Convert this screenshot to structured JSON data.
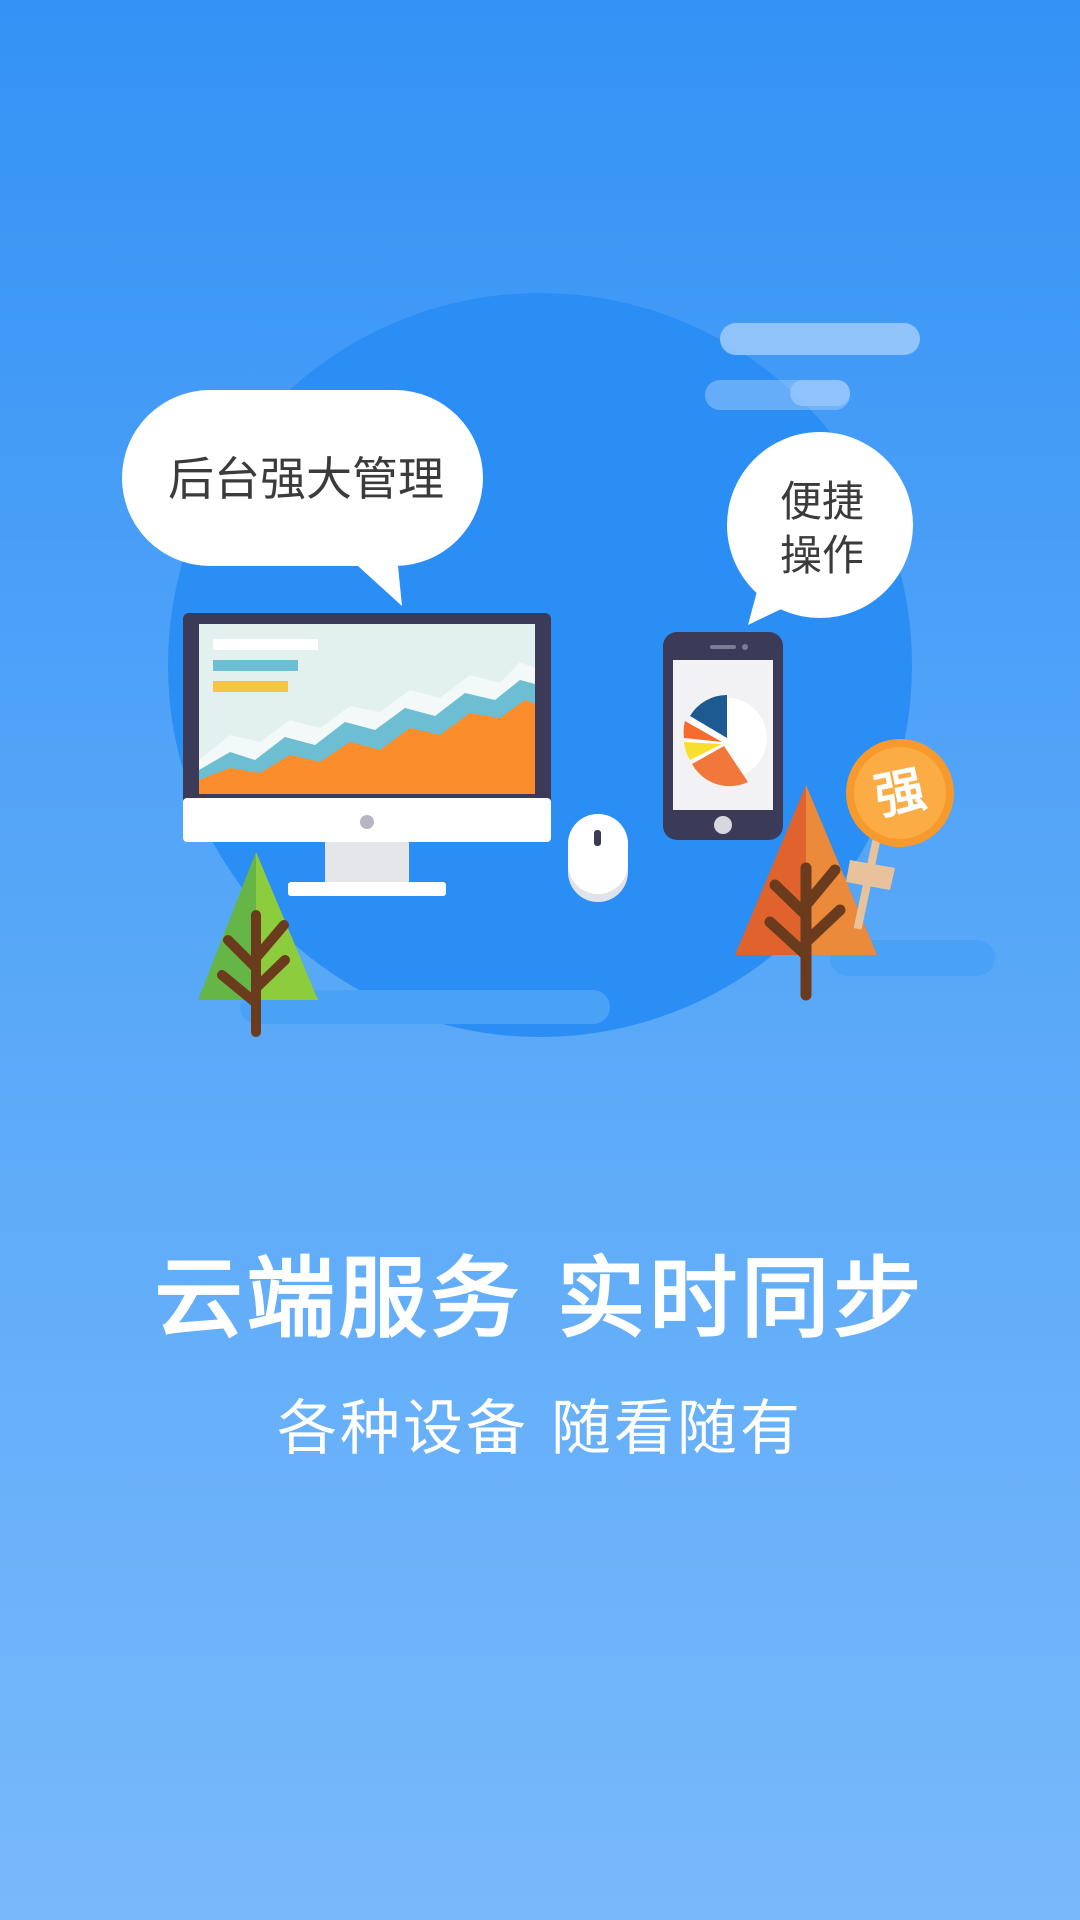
{
  "illustration": {
    "bubble_left_text": "后台强大管理",
    "bubble_right_line1": "便捷",
    "bubble_right_line2": "操作",
    "sign_text": "强"
  },
  "headline": {
    "title": "云端服务 实时同步",
    "subtitle": "各种设备 随看随有"
  },
  "colors": {
    "background_top": "#3492f6",
    "background_bottom": "#78b9fb",
    "circle": "#2b8ef5",
    "chart_orange": "#fb8d2b",
    "chart_teal": "#6dbdd3",
    "sign_orange": "#f79a2e"
  }
}
